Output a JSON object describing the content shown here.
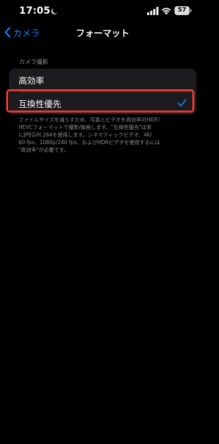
{
  "status_bar": {
    "time": "17:05",
    "battery": "57",
    "moon_icon": "moon-icon",
    "signal_icon": "cellular-signal-icon",
    "wifi_icon": "wifi-icon"
  },
  "nav": {
    "back_label": "カメラ",
    "title": "フォーマット"
  },
  "section": {
    "header": "カメラ撮影",
    "options": [
      {
        "label": "高効率",
        "selected": false
      },
      {
        "label": "互換性優先",
        "selected": true
      }
    ],
    "footer": "ファイルサイズを減らすため、写真とビデオを高効率のHEIF/\nHEVCフォーマットで撮影/録画します。\"互換性優先\"は常\nにJPEG/H.264を使用します。シネマティックビデオ、4K/\n60 fps、1080p/240 fps、およびHDRビデオを使用するには\n\"高効率\"が必要です。"
  },
  "colors": {
    "accent": "#0a84ff",
    "highlight_border": "#e53935",
    "group_background": "#1c1c1e"
  }
}
